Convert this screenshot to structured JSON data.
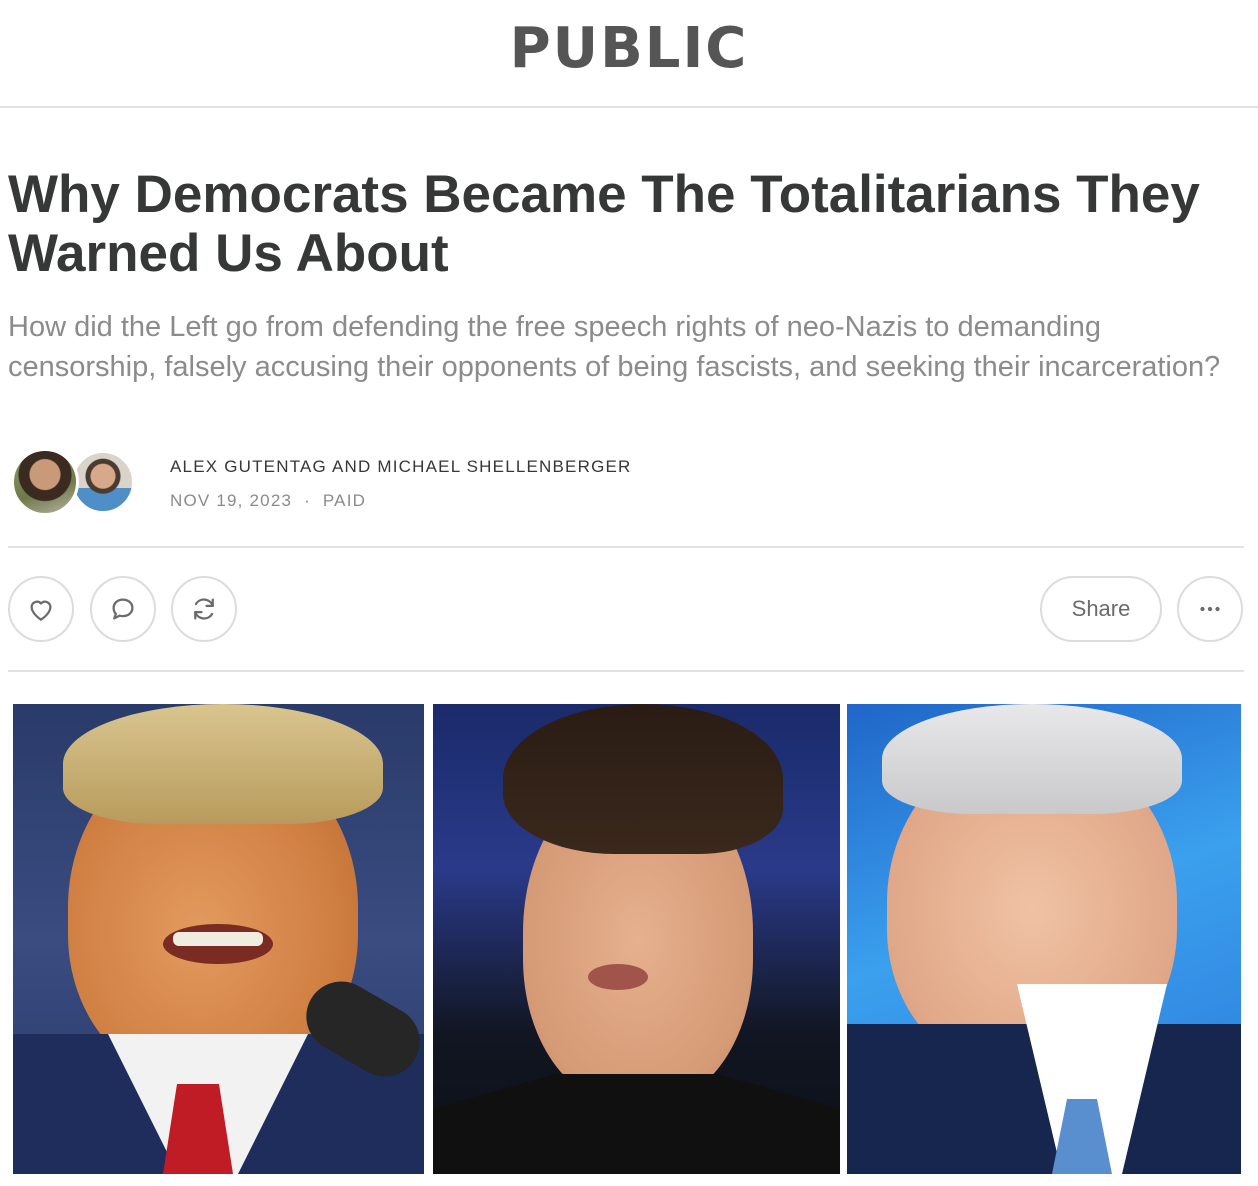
{
  "publication": {
    "name": "PUBLIC"
  },
  "article": {
    "title": "Why Democrats Became The Totalitarians They Warned Us About",
    "subtitle": "How did the Left go from defending the free speech rights of neo-Nazis to demanding censorship, falsely accusing their opponents of being fascists, and seeking their incarceration?",
    "authors": "ALEX GUTENTAG AND MICHAEL SHELLENBERGER",
    "date": "NOV 19, 2023",
    "separator": "·",
    "access": "PAID"
  },
  "actions": {
    "like_icon": "heart-icon",
    "comment_icon": "speech-bubble-icon",
    "restack_icon": "refresh-arrows-icon",
    "share_label": "Share",
    "more_icon": "ellipsis-icon"
  },
  "colors": {
    "title": "#363737",
    "subtitle": "#8b8b8b",
    "divider": "#e2e2e2",
    "logo": "#555555"
  }
}
